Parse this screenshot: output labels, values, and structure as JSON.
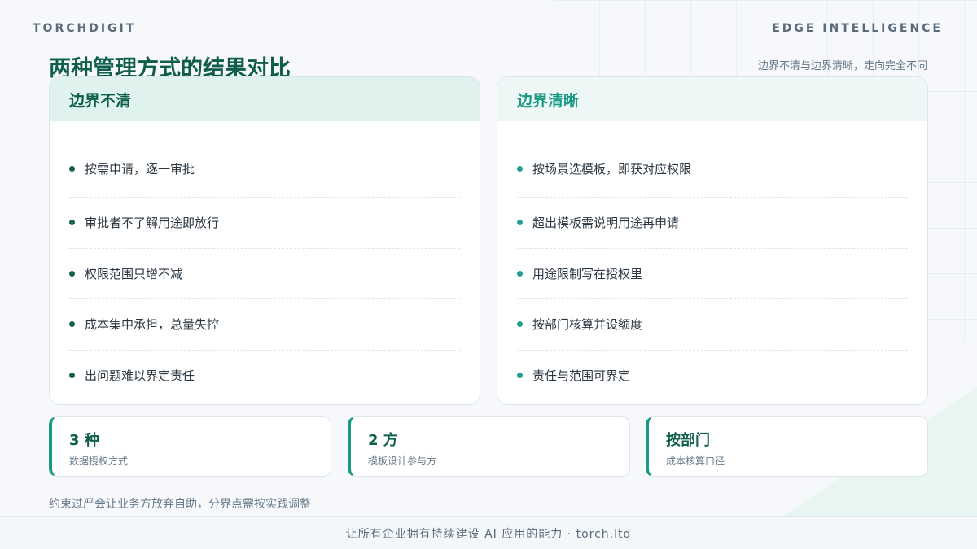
{
  "brand_left": "TORCHDIGIT",
  "brand_right": "EDGE INTELLIGENCE",
  "title": "两种管理方式的结果对比",
  "subtitle": "边界不清与边界清晰，走向完全不同",
  "left_panel": {
    "heading": "边界不清",
    "items": [
      "按需申请，逐一审批",
      "审批者不了解用途即放行",
      "权限范围只增不减",
      "成本集中承担，总量失控",
      "出问题难以界定责任"
    ]
  },
  "right_panel": {
    "heading": "边界清晰",
    "items": [
      "按场景选模板，即获对应权限",
      "超出模板需说明用途再申请",
      "用途限制写在授权里",
      "按部门核算并设额度",
      "责任与范围可界定"
    ]
  },
  "stats": [
    {
      "value": "3 种",
      "label": "数据授权方式"
    },
    {
      "value": "2 方",
      "label": "模板设计参与方"
    },
    {
      "value": "按部门",
      "label": "成本核算口径"
    }
  ],
  "note": "约束过严会让业务方放弃自助，分界点需按实践调整",
  "footer": "让所有企业拥有持续建设 AI 应用的能力 · torch.ltd",
  "colors": {
    "accent_dark": "#0f5e4c",
    "accent": "#1a9a84",
    "muted": "#66788a"
  }
}
